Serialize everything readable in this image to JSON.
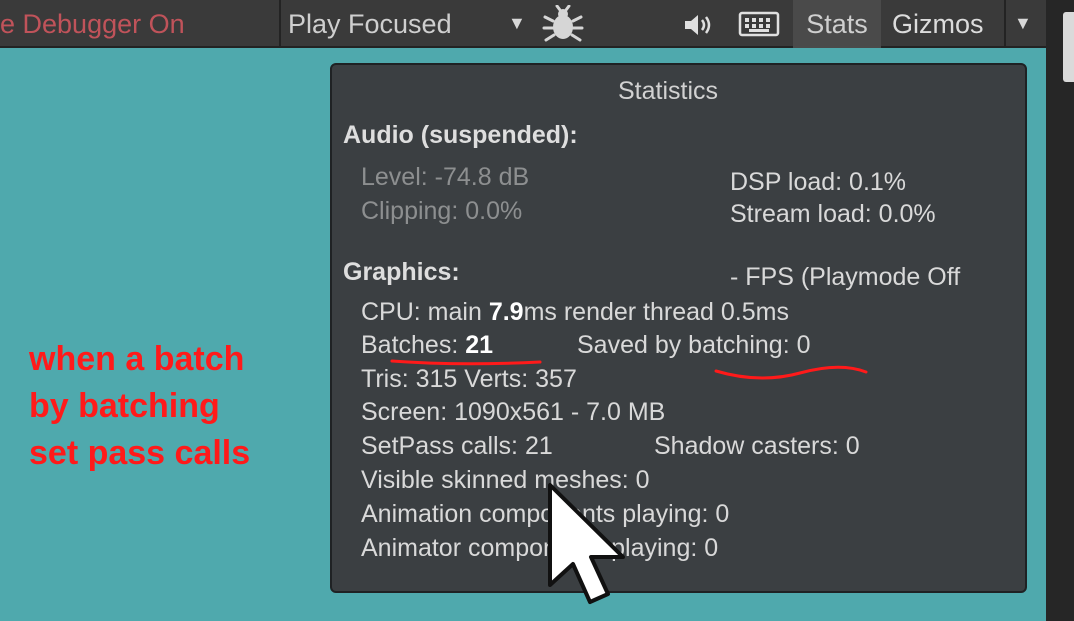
{
  "toolbar": {
    "debugger_label": "e Debugger On",
    "play_mode": "Play Focused",
    "stats_label": "Stats",
    "gizmos_label": "Gizmos",
    "icons": [
      "chevron-down-icon",
      "bug-icon",
      "audio-icon",
      "keyboard-icon"
    ]
  },
  "stats": {
    "title": "Statistics",
    "audio_header": "Audio (suspended):",
    "level": "Level: -74.8 dB",
    "clipping": "Clipping: 0.0%",
    "dsp_load": "DSP load: 0.1%",
    "stream_load": "Stream load: 0.0%",
    "graphics_header": "Graphics:",
    "fps": "- FPS (Playmode Off",
    "cpu_prefix": "CPU: main ",
    "cpu_main": "7.9",
    "cpu_suffix": "ms  render thread 0.5ms",
    "batches_prefix": "Batches: ",
    "batches_value": "21",
    "saved_batching": "Saved by batching: 0",
    "tris_verts": "Tris: 315   Verts: 357",
    "screen": "Screen: 1090x561 - 7.0 MB",
    "setpass": "SetPass calls: 21",
    "shadow_casters": "Shadow casters: 0",
    "skinned": "Visible skinned meshes: 0",
    "animation": "Animation components playing: 0",
    "animator": "Animator components playing: 0"
  },
  "annotations": {
    "lines": [
      "when a batch",
      "by batching",
      "set pass calls"
    ],
    "color": "#ff1a1a"
  },
  "colors": {
    "scene_bg": "#4fa9ad",
    "panel_bg": "#3b3f42",
    "debugger_text": "#c0535a"
  }
}
